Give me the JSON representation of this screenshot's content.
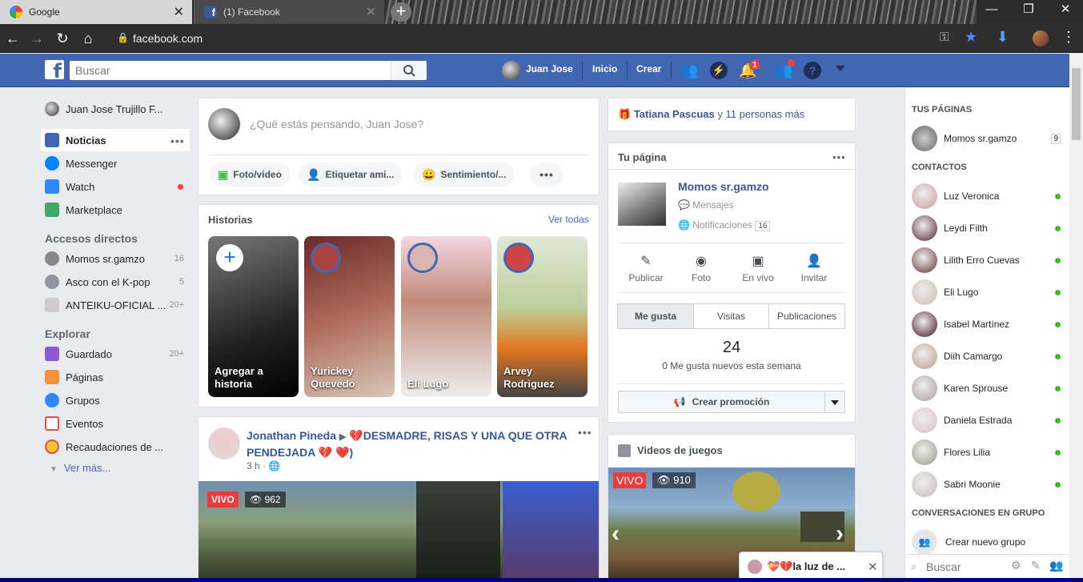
{
  "browser": {
    "tabs": [
      {
        "label": "Google",
        "active": true
      },
      {
        "label": "(1) Facebook",
        "active": false
      }
    ],
    "url": "facebook.com"
  },
  "topbar": {
    "search_placeholder": "Buscar",
    "user": "Juan Jose",
    "home": "Inicio",
    "create": "Crear",
    "notif_count": "1"
  },
  "left": {
    "profile": "Juan Jose Trujillo F...",
    "nav": [
      {
        "label": "Noticias"
      },
      {
        "label": "Messenger"
      },
      {
        "label": "Watch"
      },
      {
        "label": "Marketplace"
      }
    ],
    "shortcuts_title": "Accesos directos",
    "shortcuts": [
      {
        "label": "Momos sr.gamzo",
        "count": "16"
      },
      {
        "label": "Asco con el K-pop",
        "count": "5"
      },
      {
        "label": "ANTEIKU-OFICIAL ...",
        "count": "20+"
      }
    ],
    "explore_title": "Explorar",
    "explore": [
      {
        "label": "Guardado",
        "count": "20+"
      },
      {
        "label": "Páginas",
        "count": ""
      },
      {
        "label": "Grupos",
        "count": ""
      },
      {
        "label": "Eventos",
        "count": ""
      },
      {
        "label": "Recaudaciones de ...",
        "count": ""
      }
    ],
    "more": "Ver más..."
  },
  "composer": {
    "placeholder": "¿Qué estás pensando, Juan Jose?",
    "actions": [
      "Foto/video",
      "Etiquetar ami...",
      "Sentimiento/..."
    ]
  },
  "stories": {
    "title": "Historias",
    "see_all": "Ver todas",
    "items": [
      {
        "name": "Agregar a historia"
      },
      {
        "name": "Yurickey Quevedo"
      },
      {
        "name": "Eli Lugo"
      },
      {
        "name": "Arvey Rodriguez"
      }
    ]
  },
  "post": {
    "author": "Jonathan Pineda",
    "text": "💔DESMADRE, RISAS Y UNA QUE OTRA PENDEJADA 💔 ❤️)",
    "time": "3 h",
    "live": "VIVO",
    "viewers": "962"
  },
  "birthday": {
    "name": "Tatiana Pascuas",
    "rest": "y",
    "others": "11 personas más"
  },
  "page_card": {
    "title": "Tu página",
    "page_name": "Momos sr.gamzo",
    "messages": "Mensajes",
    "notifications": "Notificaciones",
    "notif_count": "16",
    "actions": [
      "Publicar",
      "Foto",
      "En vivo",
      "Invitar"
    ],
    "tabs": [
      "Me gusta",
      "Visitas",
      "Publicaciones"
    ],
    "likes": "24",
    "likes_note": "0 Me gusta nuevos esta semana",
    "promo": "Crear promoción"
  },
  "games": {
    "title": "Videos de juegos",
    "live": "VIVO",
    "viewers": "910"
  },
  "chat": {
    "pages_title": "TUS PÁGINAS",
    "page": {
      "name": "Momos sr.gamzo",
      "count": "9"
    },
    "contacts_title": "CONTACTOS",
    "contacts": [
      "Luz Veronica",
      "Leydi Filth",
      "Lilith Erro Cuevas",
      "Eli Lugo",
      "Isabel Martínez",
      "Diih Camargo",
      "Karen Sprouse",
      "Daniela Estrada",
      "Flores Lilia",
      "Sabri Moonie"
    ],
    "groups_title": "CONVERSACIONES EN GRUPO",
    "new_group": "Crear nuevo grupo",
    "search_placeholder": "Buscar"
  },
  "popup_chat": {
    "title": "💝💔la luz de ..."
  }
}
